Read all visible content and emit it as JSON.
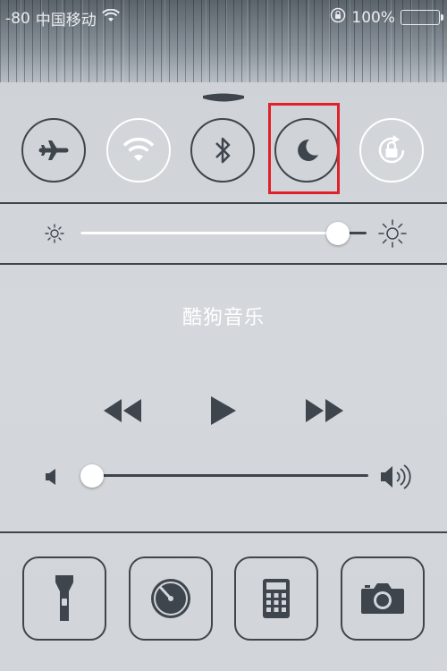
{
  "status_bar": {
    "signal": "-80",
    "carrier": "中国移动",
    "battery_percent": "100%",
    "battery_level": 1.0
  },
  "toggles": [
    {
      "name": "airplane-mode",
      "icon": "airplane-icon",
      "on": false
    },
    {
      "name": "wifi",
      "icon": "wifi-icon",
      "on": true
    },
    {
      "name": "bluetooth",
      "icon": "bluetooth-icon",
      "on": false
    },
    {
      "name": "do-not-disturb",
      "icon": "moon-icon",
      "on": false,
      "highlighted": true
    },
    {
      "name": "rotation-lock",
      "icon": "rotation-lock-icon",
      "on": true
    }
  ],
  "brightness": {
    "level": 0.9
  },
  "now_playing": {
    "title": "酷狗音乐"
  },
  "volume": {
    "level": 0.03
  },
  "shortcuts": [
    {
      "name": "flashlight",
      "icon": "flashlight-icon"
    },
    {
      "name": "timer",
      "icon": "timer-icon"
    },
    {
      "name": "calculator",
      "icon": "calculator-icon"
    },
    {
      "name": "camera",
      "icon": "camera-icon"
    }
  ],
  "colors": {
    "panel": "#d2d6da",
    "icon_dark": "#3e454d",
    "highlight": "#e0202a",
    "battery": "#3fbf3a"
  }
}
